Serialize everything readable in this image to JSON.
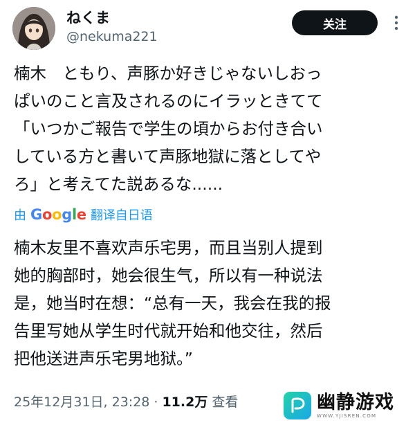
{
  "header": {
    "display_name": "ねくま",
    "handle": "@nekuma221",
    "follow_label": "关注",
    "more_icon": "more-vertical-icon"
  },
  "tweet": {
    "lines": [
      "楠木　ともり、声豚か好きじゃないしおっ",
      "ぱいのこと言及されるのにイラッときてて",
      "「いつかご報告で学生の頃からお付き合い",
      "している方と書いて声豚地獄に落としてや",
      "ろ」と考えてた説あるな......"
    ]
  },
  "translation_bar": {
    "by": "由",
    "google_letters": [
      "G",
      "o",
      "o",
      "g",
      "l",
      "e"
    ],
    "translated_from": "翻译自日语"
  },
  "translation": {
    "lines": [
      "楠木友里不喜欢声乐宅男，而且当别人提到",
      "她的胸部时，她会很生气，所以有一种说法",
      "是，她当时在想：“总有一天，我会在我的报",
      "告里写她从学生时代就开始和他交往，然后",
      "把他送进声乐宅男地狱。”"
    ]
  },
  "meta": {
    "datetime": "25年12月31日, 23:28 ·",
    "views": "11.2万",
    "views_label": "查看"
  },
  "watermark": {
    "name": "幽静游戏",
    "url": "WWW.YJISREN.COM"
  },
  "colors": {
    "text": "#0f1419",
    "secondary": "#536471",
    "link": "#1d9bf0",
    "button_bg": "#0f1419"
  }
}
